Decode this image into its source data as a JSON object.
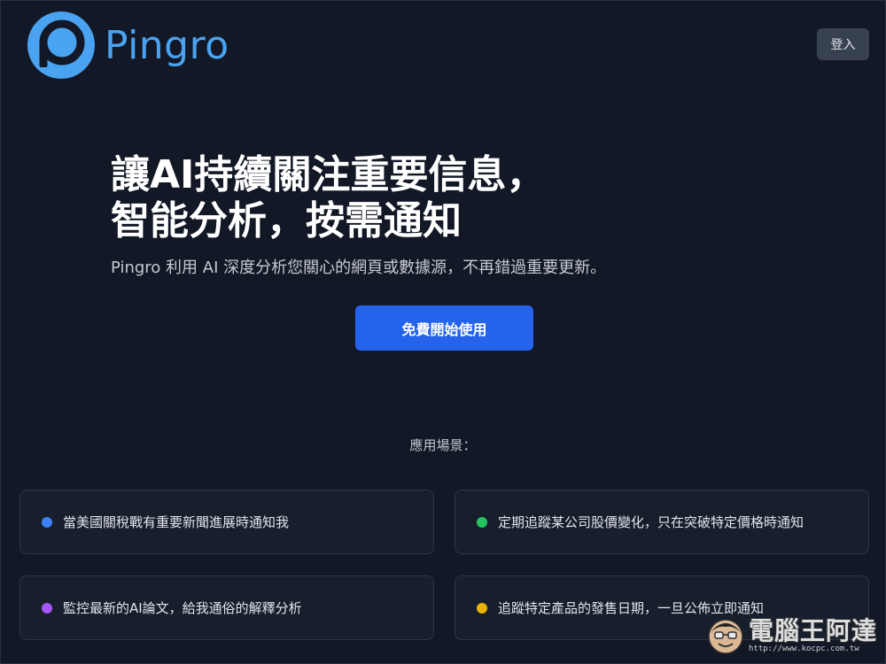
{
  "header": {
    "brand": "Pingro",
    "login_label": "登入"
  },
  "hero": {
    "title_line1": "讓AI持續關注重要信息，",
    "title_line2": "智能分析，按需通知",
    "subtitle": "Pingro 利用 AI 深度分析您關心的網頁或數據源，不再錯過重要更新。",
    "cta_label": "免費開始使用"
  },
  "use_cases": {
    "label": "應用場景：",
    "items": [
      {
        "text": "當美國關稅戰有重要新聞進展時通知我",
        "color": "#3b82f6"
      },
      {
        "text": "定期追蹤某公司股價變化，只在突破特定價格時通知",
        "color": "#22c55e"
      },
      {
        "text": "監控最新的AI論文，給我通俗的解釋分析",
        "color": "#a855f7"
      },
      {
        "text": "追蹤特定產品的發售日期，一旦公佈立即通知",
        "color": "#eab308"
      }
    ]
  },
  "watermark": {
    "title": "電腦王阿達",
    "url": "http://www.kocpc.com.tw"
  },
  "colors": {
    "background": "#121826",
    "brand": "#4aa3f0",
    "cta": "#2563eb"
  },
  "icons": {
    "logo": "pingro-logo-icon",
    "watermark": "mascot-face-icon"
  }
}
